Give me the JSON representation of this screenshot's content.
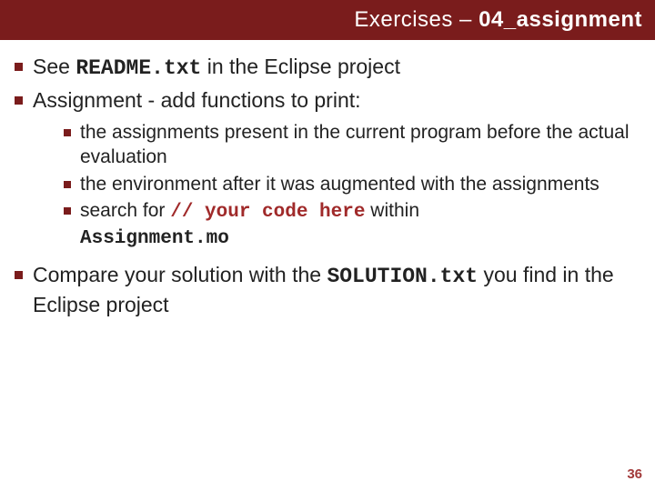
{
  "header": {
    "prefix": "Exercises – ",
    "bold": "04_assignment"
  },
  "bullets": {
    "b1_pre": "See ",
    "b1_code": "README.txt",
    "b1_post": " in the Eclipse project",
    "b2": "Assignment - add functions to print:",
    "sub1": "the assignments present in the current program before the actual evaluation",
    "sub2": "the environment after it was augmented with the assignments",
    "sub3_pre": "search for ",
    "sub3_code": "// your code here",
    "sub3_mid": " within ",
    "sub3_code2": "Assignment.mo",
    "b3_pre": "Compare your solution with the ",
    "b3_code": "SOLUTION.txt",
    "b3_post": " you find in the Eclipse project"
  },
  "page": "36"
}
